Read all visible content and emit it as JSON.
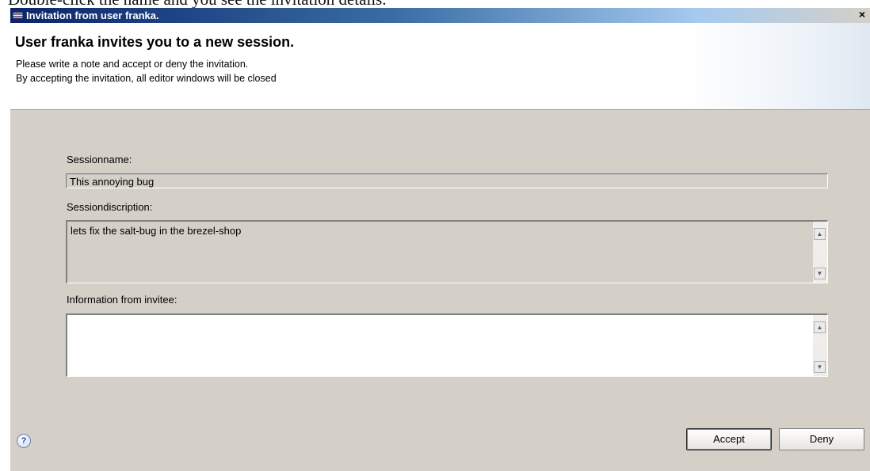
{
  "caption": "Double-click the name and you see the invitation details.",
  "window": {
    "title": "Invitation from user franka.",
    "close_glyph": "×"
  },
  "banner": {
    "heading": "User franka invites you to a new session.",
    "line1": "Please write a note and accept or deny the invitation.",
    "line2": "By accepting the invitation, all editor windows will be closed"
  },
  "form": {
    "sessionname_label": "Sessionname:",
    "sessionname_value": "This annoying bug",
    "description_label": "Sessiondiscription:",
    "description_value": "lets fix the salt-bug in the brezel-shop",
    "info_label": "Information from invitee:",
    "info_value": ""
  },
  "buttons": {
    "accept": "Accept",
    "deny": "Deny",
    "help_glyph": "?"
  },
  "scroll": {
    "up_glyph": "▲",
    "down_glyph": "▼"
  }
}
